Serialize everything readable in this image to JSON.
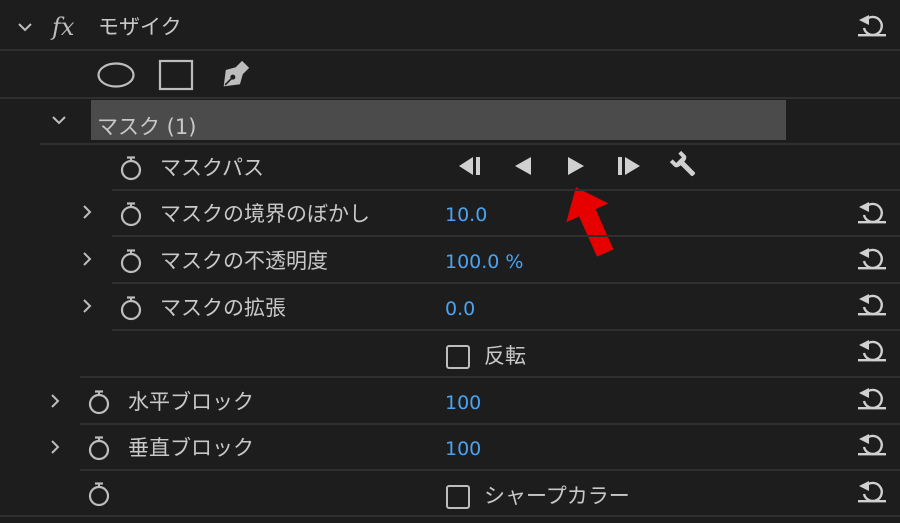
{
  "effect": {
    "fx_label": "fx",
    "name": "モザイク"
  },
  "mask": {
    "title": "マスク (1)",
    "path_label": "マスクパス",
    "feather": {
      "label": "マスクの境界のぼかし",
      "value": "10.0"
    },
    "opacity": {
      "label": "マスクの不透明度",
      "value": "100.0 %"
    },
    "expansion": {
      "label": "マスクの拡張",
      "value": "0.0"
    },
    "invert": {
      "label": "反転"
    }
  },
  "params": {
    "h_blocks": {
      "label": "水平ブロック",
      "value": "100"
    },
    "v_blocks": {
      "label": "垂直ブロック",
      "value": "100"
    },
    "sharp_colors": {
      "label": "シャープカラー"
    }
  },
  "colors": {
    "background": "#1d1d1d",
    "text": "#c8c8c8",
    "value": "#4aa3f0",
    "highlight_bar": "#4b4b4b",
    "annotation_arrow": "#e60000"
  },
  "icons": {
    "mask_tools": [
      "ellipse-mask-icon",
      "rectangle-mask-icon",
      "pen-mask-icon"
    ],
    "track_controls": [
      "track-selected-backward-one-frame-icon",
      "track-selected-backward-icon",
      "track-selected-forward-icon",
      "track-selected-forward-one-frame-icon",
      "wrench-icon"
    ]
  }
}
